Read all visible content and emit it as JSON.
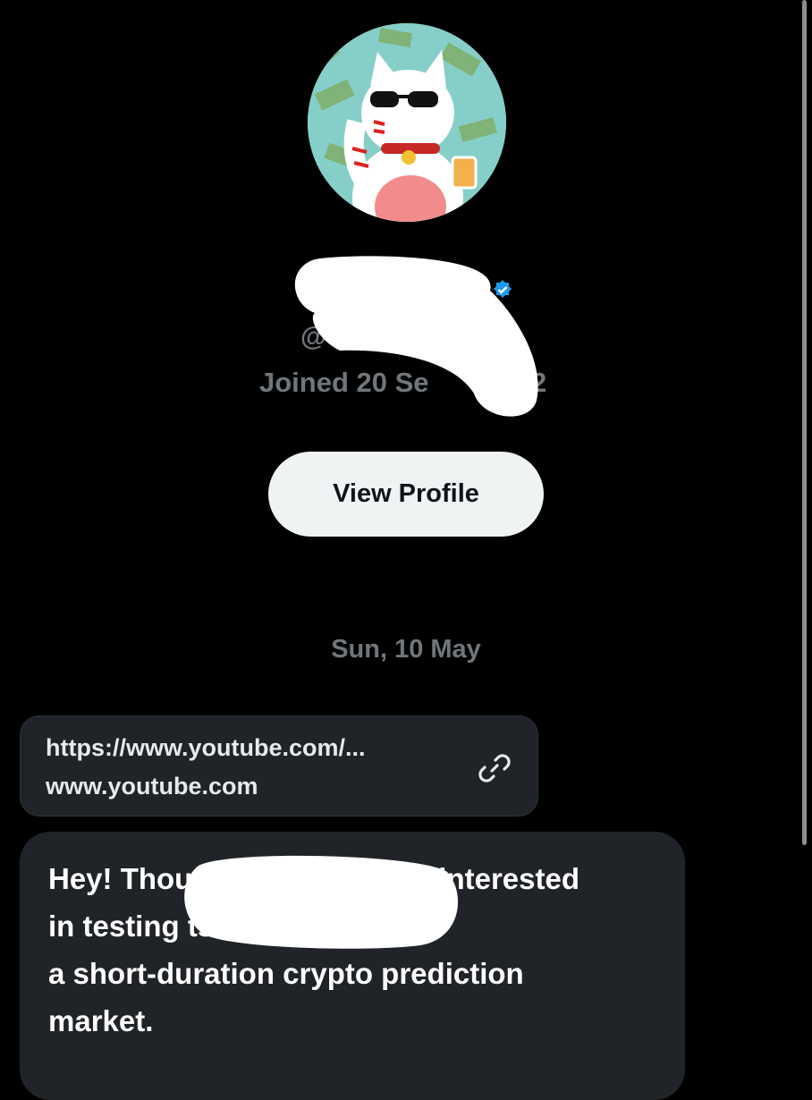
{
  "profile": {
    "handle_prefix": "@",
    "joined_visible_start": "Joined 20 Se",
    "joined_visible_end": "2",
    "view_profile_label": "View Profile",
    "verified_color": "#1d9bf0"
  },
  "conversation": {
    "date_separator": "Sun, 10 May",
    "link_card": {
      "url": "https://www.youtube.com/...",
      "domain": "www.youtube.com",
      "icon": "link-icon"
    },
    "message": {
      "text": "Hey! Thought you might be interested\nin testing                              ts early. It's\na short-duration crypto prediction\nmarket."
    }
  },
  "colors": {
    "background": "#000000",
    "bubble": "#202327",
    "muted_text": "#71767b",
    "button_bg": "#eff3f4"
  }
}
